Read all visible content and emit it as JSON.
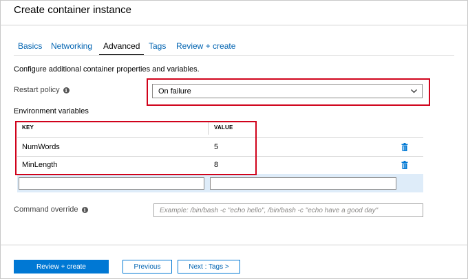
{
  "title": "Create container instance",
  "tabs": [
    {
      "label": "Basics",
      "active": false
    },
    {
      "label": "Networking",
      "active": false
    },
    {
      "label": "Advanced",
      "active": true
    },
    {
      "label": "Tags",
      "active": false
    },
    {
      "label": "Review + create",
      "active": false
    }
  ],
  "description": "Configure additional container properties and variables.",
  "restart_policy": {
    "label": "Restart policy",
    "value": "On failure",
    "icon": "info-icon"
  },
  "env_vars": {
    "label": "Environment variables",
    "headers": {
      "key": "KEY",
      "value": "VALUE"
    },
    "rows": [
      {
        "key": "NumWords",
        "value": "5"
      },
      {
        "key": "MinLength",
        "value": "8"
      }
    ],
    "new_key": "",
    "new_value": ""
  },
  "command_override": {
    "label": "Command override",
    "placeholder": "Example: /bin/bash -c \"echo hello\", /bin/bash -c \"echo have a good day\"",
    "icon": "info-icon"
  },
  "footer": {
    "review_label": "Review + create",
    "previous_label": "Previous",
    "next_label": "Next : Tags >"
  },
  "colors": {
    "accent": "#0078d4",
    "highlight": "#d0021b",
    "new_row_bg": "#deecf9"
  }
}
